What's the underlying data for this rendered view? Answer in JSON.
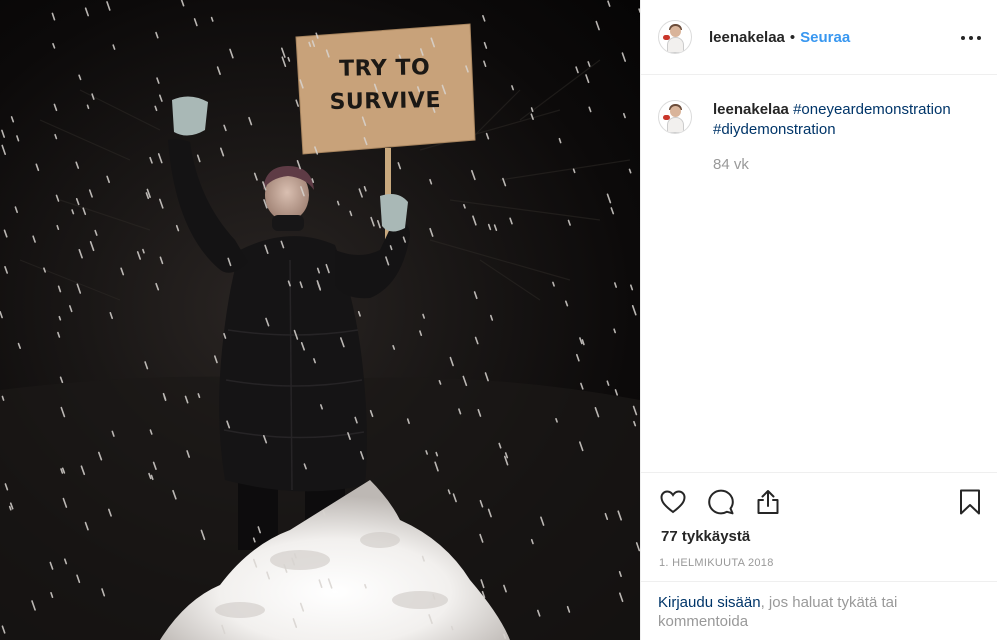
{
  "photo": {
    "sign_text": "TRY TO\nSURVIVE"
  },
  "header": {
    "username": "leenakelaa",
    "separator": "•",
    "follow_label": "Seuraa",
    "more_icon": "more-options-icon"
  },
  "caption": {
    "username": "leenakelaa",
    "hashtags": [
      "#oneyeardemonstration",
      "#diydemonstration"
    ],
    "time_ago": "84 vk"
  },
  "actions": {
    "icons": [
      "heart-icon",
      "comment-icon",
      "share-icon",
      "bookmark-icon"
    ],
    "likes_label": "77 tykkäystä",
    "date": "1. helmikuuta 2018"
  },
  "login_prompt": {
    "link_text": "Kirjaudu sisään",
    "rest_text": ", jos haluat tykätä tai kommentoida"
  },
  "colors": {
    "link_blue": "#3897f0",
    "hashtag_blue": "#003569",
    "muted_gray": "#999999",
    "border": "#efefef"
  }
}
